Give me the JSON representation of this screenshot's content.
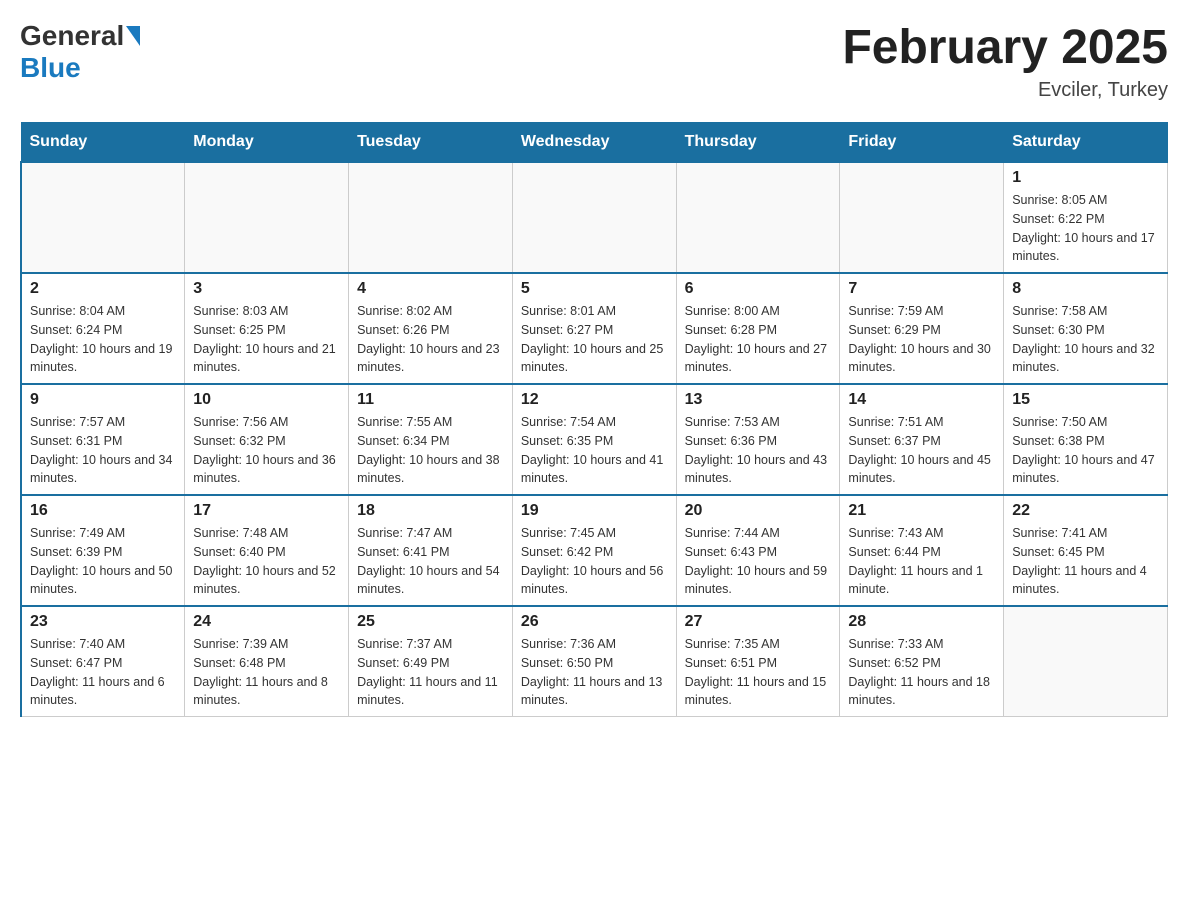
{
  "header": {
    "logo_general": "General",
    "logo_blue": "Blue",
    "month_title": "February 2025",
    "location": "Evciler, Turkey"
  },
  "weekdays": [
    "Sunday",
    "Monday",
    "Tuesday",
    "Wednesday",
    "Thursday",
    "Friday",
    "Saturday"
  ],
  "weeks": [
    [
      {
        "day": "",
        "info": ""
      },
      {
        "day": "",
        "info": ""
      },
      {
        "day": "",
        "info": ""
      },
      {
        "day": "",
        "info": ""
      },
      {
        "day": "",
        "info": ""
      },
      {
        "day": "",
        "info": ""
      },
      {
        "day": "1",
        "info": "Sunrise: 8:05 AM\nSunset: 6:22 PM\nDaylight: 10 hours and 17 minutes."
      }
    ],
    [
      {
        "day": "2",
        "info": "Sunrise: 8:04 AM\nSunset: 6:24 PM\nDaylight: 10 hours and 19 minutes."
      },
      {
        "day": "3",
        "info": "Sunrise: 8:03 AM\nSunset: 6:25 PM\nDaylight: 10 hours and 21 minutes."
      },
      {
        "day": "4",
        "info": "Sunrise: 8:02 AM\nSunset: 6:26 PM\nDaylight: 10 hours and 23 minutes."
      },
      {
        "day": "5",
        "info": "Sunrise: 8:01 AM\nSunset: 6:27 PM\nDaylight: 10 hours and 25 minutes."
      },
      {
        "day": "6",
        "info": "Sunrise: 8:00 AM\nSunset: 6:28 PM\nDaylight: 10 hours and 27 minutes."
      },
      {
        "day": "7",
        "info": "Sunrise: 7:59 AM\nSunset: 6:29 PM\nDaylight: 10 hours and 30 minutes."
      },
      {
        "day": "8",
        "info": "Sunrise: 7:58 AM\nSunset: 6:30 PM\nDaylight: 10 hours and 32 minutes."
      }
    ],
    [
      {
        "day": "9",
        "info": "Sunrise: 7:57 AM\nSunset: 6:31 PM\nDaylight: 10 hours and 34 minutes."
      },
      {
        "day": "10",
        "info": "Sunrise: 7:56 AM\nSunset: 6:32 PM\nDaylight: 10 hours and 36 minutes."
      },
      {
        "day": "11",
        "info": "Sunrise: 7:55 AM\nSunset: 6:34 PM\nDaylight: 10 hours and 38 minutes."
      },
      {
        "day": "12",
        "info": "Sunrise: 7:54 AM\nSunset: 6:35 PM\nDaylight: 10 hours and 41 minutes."
      },
      {
        "day": "13",
        "info": "Sunrise: 7:53 AM\nSunset: 6:36 PM\nDaylight: 10 hours and 43 minutes."
      },
      {
        "day": "14",
        "info": "Sunrise: 7:51 AM\nSunset: 6:37 PM\nDaylight: 10 hours and 45 minutes."
      },
      {
        "day": "15",
        "info": "Sunrise: 7:50 AM\nSunset: 6:38 PM\nDaylight: 10 hours and 47 minutes."
      }
    ],
    [
      {
        "day": "16",
        "info": "Sunrise: 7:49 AM\nSunset: 6:39 PM\nDaylight: 10 hours and 50 minutes."
      },
      {
        "day": "17",
        "info": "Sunrise: 7:48 AM\nSunset: 6:40 PM\nDaylight: 10 hours and 52 minutes."
      },
      {
        "day": "18",
        "info": "Sunrise: 7:47 AM\nSunset: 6:41 PM\nDaylight: 10 hours and 54 minutes."
      },
      {
        "day": "19",
        "info": "Sunrise: 7:45 AM\nSunset: 6:42 PM\nDaylight: 10 hours and 56 minutes."
      },
      {
        "day": "20",
        "info": "Sunrise: 7:44 AM\nSunset: 6:43 PM\nDaylight: 10 hours and 59 minutes."
      },
      {
        "day": "21",
        "info": "Sunrise: 7:43 AM\nSunset: 6:44 PM\nDaylight: 11 hours and 1 minute."
      },
      {
        "day": "22",
        "info": "Sunrise: 7:41 AM\nSunset: 6:45 PM\nDaylight: 11 hours and 4 minutes."
      }
    ],
    [
      {
        "day": "23",
        "info": "Sunrise: 7:40 AM\nSunset: 6:47 PM\nDaylight: 11 hours and 6 minutes."
      },
      {
        "day": "24",
        "info": "Sunrise: 7:39 AM\nSunset: 6:48 PM\nDaylight: 11 hours and 8 minutes."
      },
      {
        "day": "25",
        "info": "Sunrise: 7:37 AM\nSunset: 6:49 PM\nDaylight: 11 hours and 11 minutes."
      },
      {
        "day": "26",
        "info": "Sunrise: 7:36 AM\nSunset: 6:50 PM\nDaylight: 11 hours and 13 minutes."
      },
      {
        "day": "27",
        "info": "Sunrise: 7:35 AM\nSunset: 6:51 PM\nDaylight: 11 hours and 15 minutes."
      },
      {
        "day": "28",
        "info": "Sunrise: 7:33 AM\nSunset: 6:52 PM\nDaylight: 11 hours and 18 minutes."
      },
      {
        "day": "",
        "info": ""
      }
    ]
  ]
}
